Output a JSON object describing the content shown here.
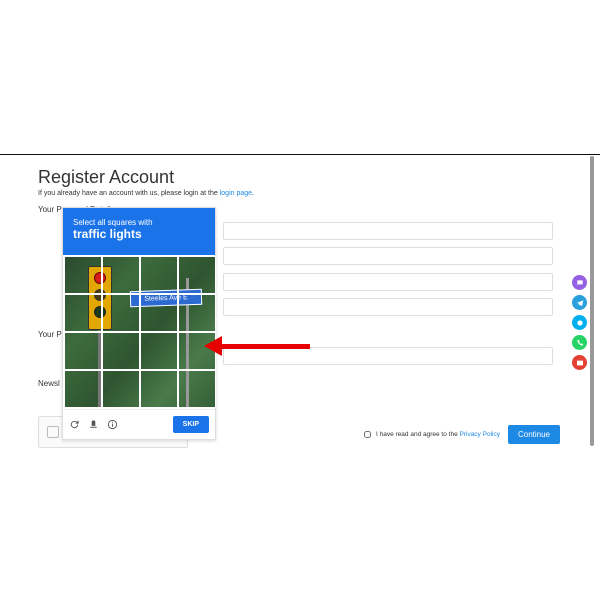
{
  "page": {
    "title": "Register Account",
    "subtext_prefix": "If you already have an account with us, please login at the ",
    "subtext_link": "login page",
    "section_legend": "Your Personal Details",
    "password_legend": "Your P",
    "newsletter_label": "Newsl"
  },
  "captcha": {
    "line1": "Select all squares with",
    "line2": "traffic lights",
    "sign_text": "Steeles Ave E",
    "skip_label": "SKIP"
  },
  "agree": {
    "prefix": "I have read and agree to the ",
    "link": "Privacy Policy"
  },
  "buttons": {
    "continue": "Continue"
  },
  "floats": [
    "chat",
    "telegram",
    "skype",
    "whatsapp",
    "mail"
  ]
}
